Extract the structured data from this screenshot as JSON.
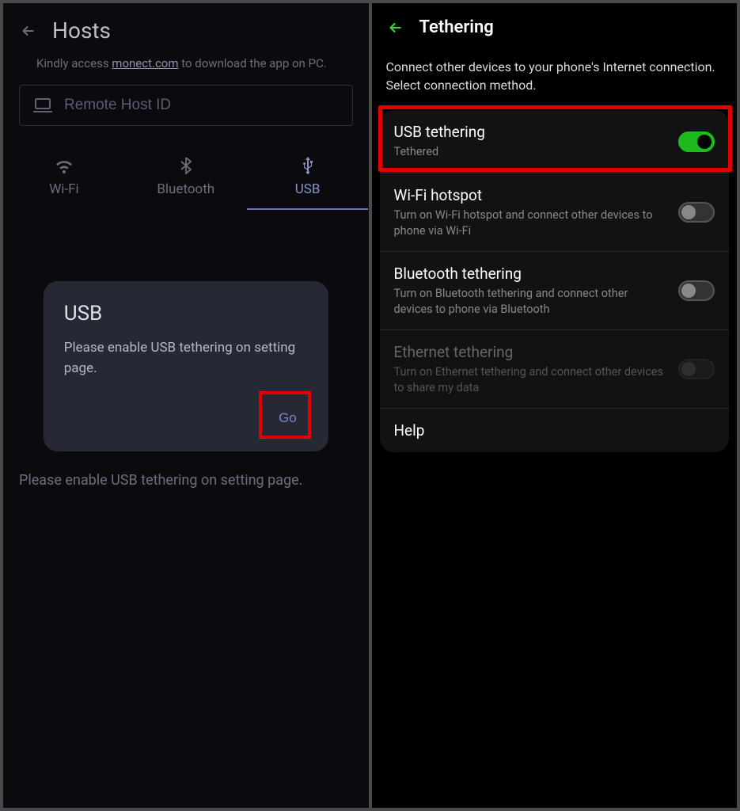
{
  "left": {
    "title": "Hosts",
    "subtext_pre": "Kindly access ",
    "subtext_link": "monect.com",
    "subtext_post": " to download the app on PC.",
    "input_placeholder": "Remote Host ID",
    "tabs": [
      {
        "label": "Wi-Fi"
      },
      {
        "label": "Bluetooth"
      },
      {
        "label": "USB"
      }
    ],
    "dialog": {
      "title": "USB",
      "body": "Please enable USB tethering on setting page.",
      "go": "Go"
    },
    "bottom_hint": "Please enable USB tethering on setting page."
  },
  "right": {
    "title": "Tethering",
    "sub": "Connect other devices to your phone's Internet connection. Select connection method.",
    "rows": {
      "usb": {
        "title": "USB tethering",
        "desc": "Tethered",
        "on": true
      },
      "wifi": {
        "title": "Wi-Fi hotspot",
        "desc": "Turn on Wi-Fi hotspot and connect other devices to phone via Wi-Fi",
        "on": false
      },
      "bt": {
        "title": "Bluetooth tethering",
        "desc": "Turn on Bluetooth tethering and connect other devices to phone via Bluetooth",
        "on": false
      },
      "eth": {
        "title": "Ethernet tethering",
        "desc": "Turn on Ethernet tethering and connect other devices to share my data",
        "on": false,
        "disabled": true
      },
      "help": {
        "title": "Help"
      }
    }
  },
  "colors": {
    "highlight": "#e20000",
    "accent_green": "#1db91d",
    "accent_purple": "#7a85c9"
  }
}
